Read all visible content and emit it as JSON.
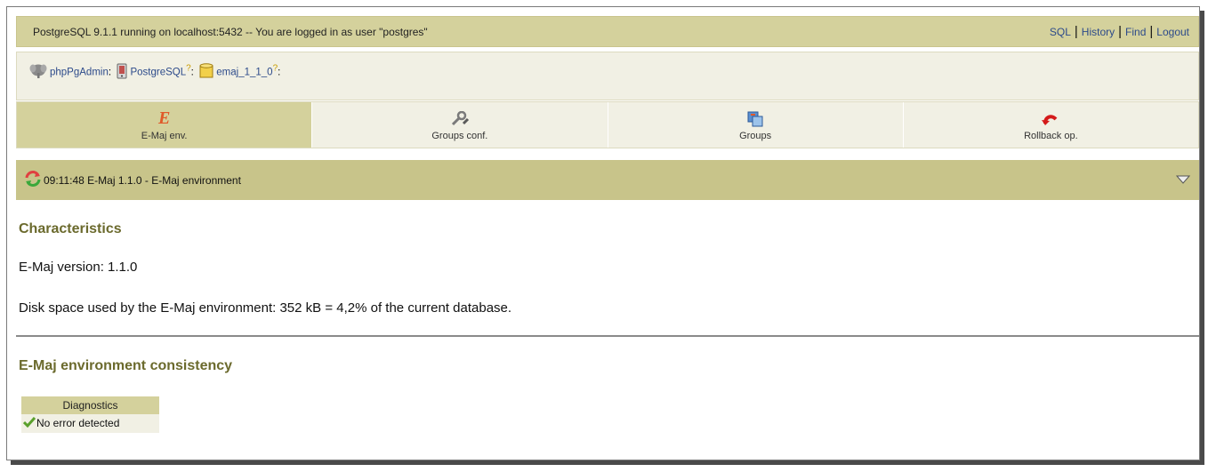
{
  "topbar": {
    "status_text": "PostgreSQL 9.1.1 running on localhost:5432 -- You are logged in as user \"postgres\"",
    "links": [
      "SQL",
      "History",
      "Find",
      "Logout"
    ]
  },
  "trail": {
    "items": [
      {
        "label": "phpPgAdmin",
        "suffix": ":"
      },
      {
        "label": "PostgreSQL",
        "help": "?",
        "suffix": ":"
      },
      {
        "label": "emaj_1_1_0",
        "help": "?",
        "suffix": ":"
      }
    ]
  },
  "tabs": [
    {
      "label": "E-Maj env.",
      "icon": "emaj-e-icon",
      "active": true
    },
    {
      "label": "Groups conf.",
      "icon": "tools-icon",
      "active": false
    },
    {
      "label": "Groups",
      "icon": "groups-icon",
      "active": false
    },
    {
      "label": "Rollback op.",
      "icon": "rollback-arrow-icon",
      "active": false
    }
  ],
  "page_title": {
    "time": "09:11:48",
    "product": "E-Maj 1.1.0",
    "separator": "-",
    "title": "E-Maj environment"
  },
  "characteristics": {
    "heading": "Characteristics",
    "version_line": "E-Maj version: 1.1.0",
    "disk_line": "Disk space used by the E-Maj environment: 352 kB = 4,2% of the current database."
  },
  "consistency": {
    "heading": "E-Maj environment consistency",
    "table_header": "Diagnostics",
    "rows": [
      "No error detected"
    ]
  },
  "colors": {
    "topbar": "#d4d19c",
    "title_bar": "#c8c48a",
    "heading": "#6b6a2d",
    "link": "#2c4a8a"
  }
}
